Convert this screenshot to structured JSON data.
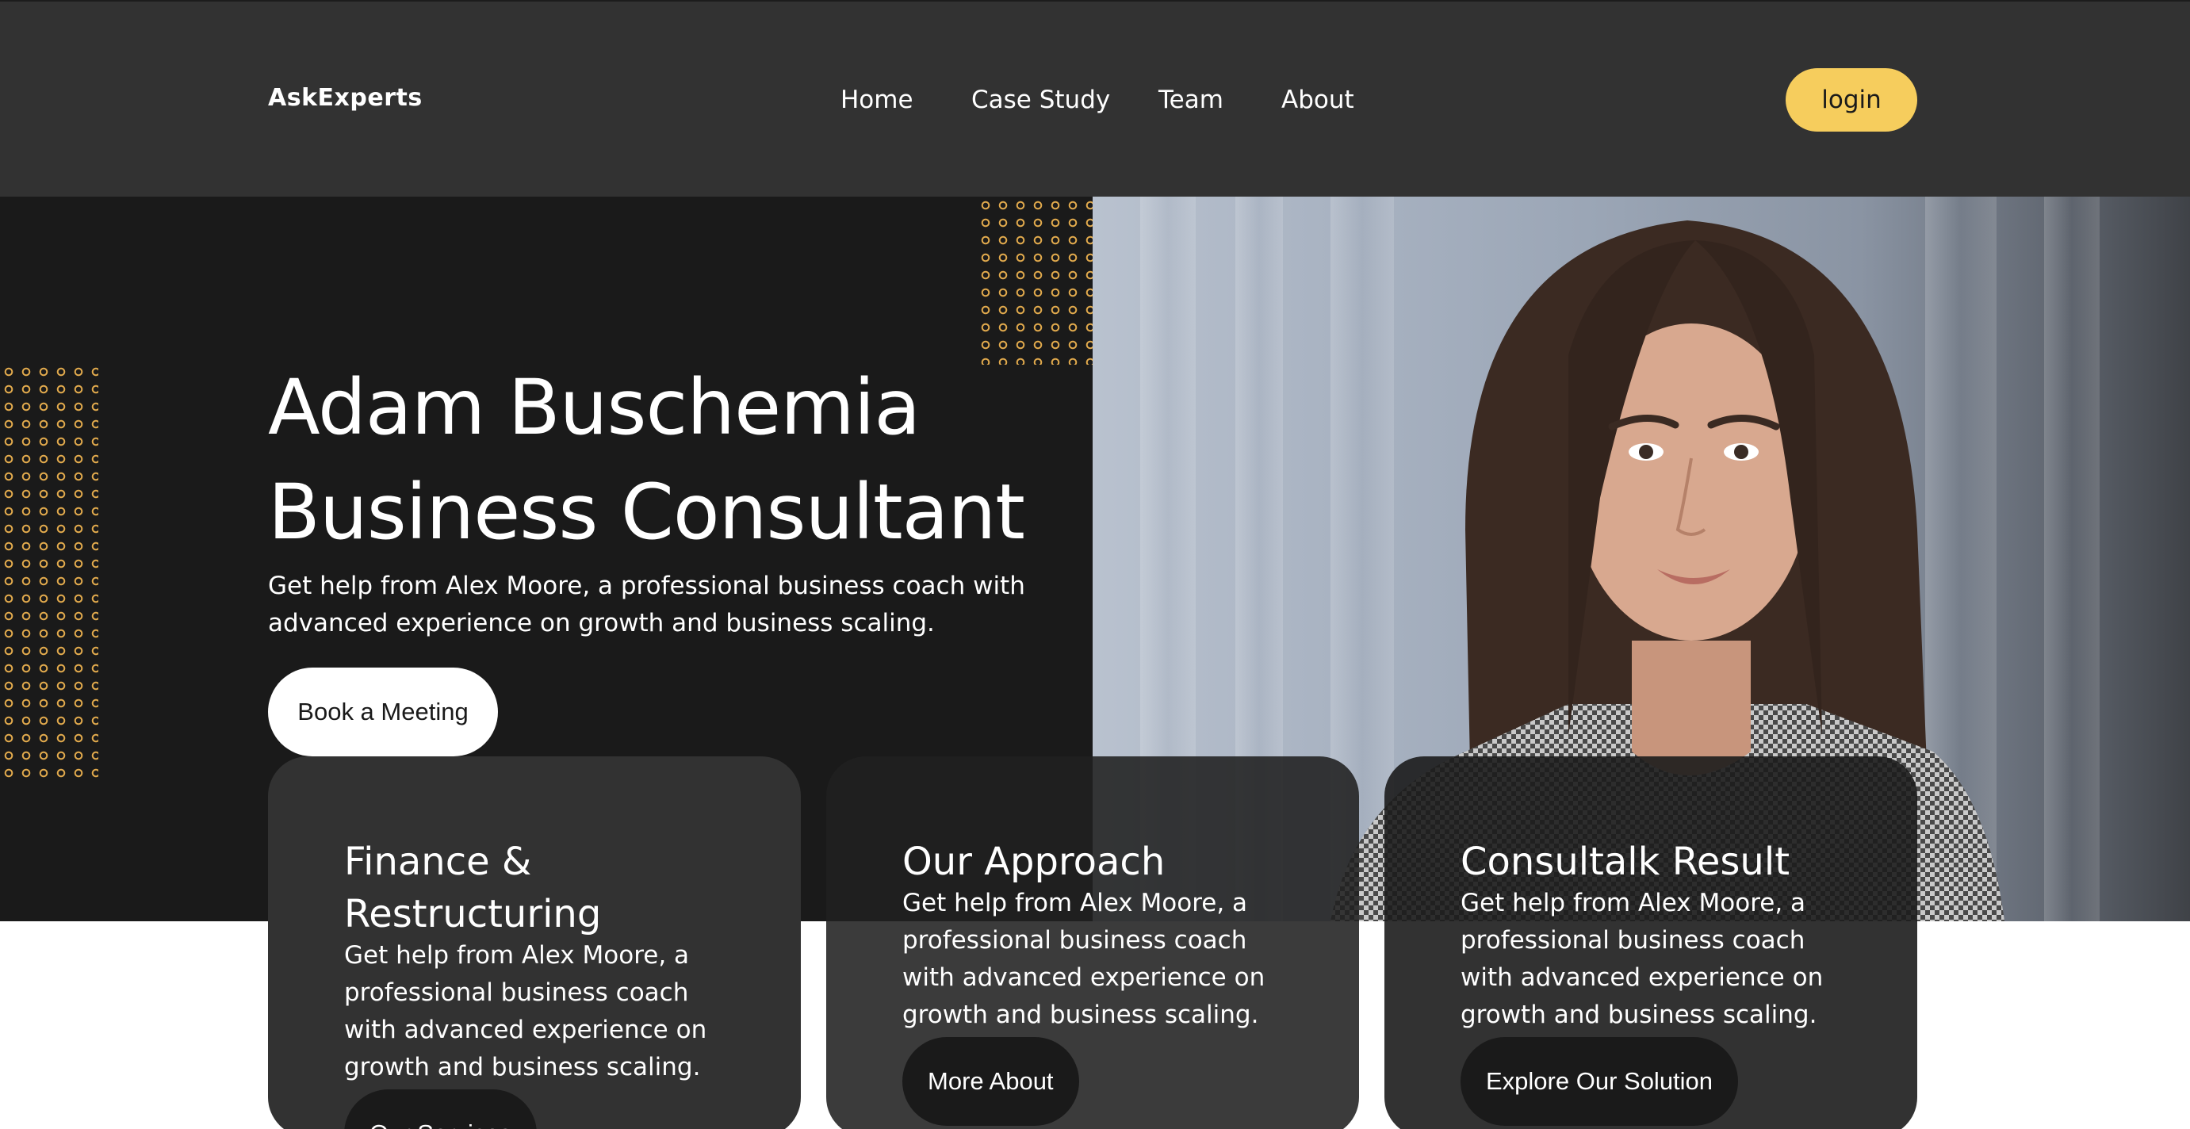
{
  "header": {
    "logo": "AskExperts",
    "nav": [
      {
        "label": "Home"
      },
      {
        "label": "Case Study"
      },
      {
        "label": "Team"
      },
      {
        "label": "About"
      }
    ],
    "login_label": "login"
  },
  "hero": {
    "title_line1": "Adam Buschemia",
    "title_line2": "Business Consultant",
    "description": "Get help from Alex Moore, a professional business coach with advanced experience on growth and business scaling.",
    "cta_label": "Book a Meeting"
  },
  "cards": [
    {
      "title": "Finance & Restructuring",
      "description": "Get help from Alex Moore, a professional business coach with advanced experience on growth and business scaling.",
      "button_label": "Our Services"
    },
    {
      "title": "Our Approach",
      "description": "Get help from Alex Moore, a professional business coach with advanced experience on growth and business scaling.",
      "button_label": "More About"
    },
    {
      "title": "Consultalk Result",
      "description": "Get help from Alex Moore, a professional business coach with advanced experience on growth and business scaling.",
      "button_label": "Explore Our Solution"
    }
  ],
  "colors": {
    "header_bg": "#323232",
    "hero_bg": "#1a1a1a",
    "accent": "#f6cd5d",
    "dot_pattern": "#e3ab4d"
  }
}
